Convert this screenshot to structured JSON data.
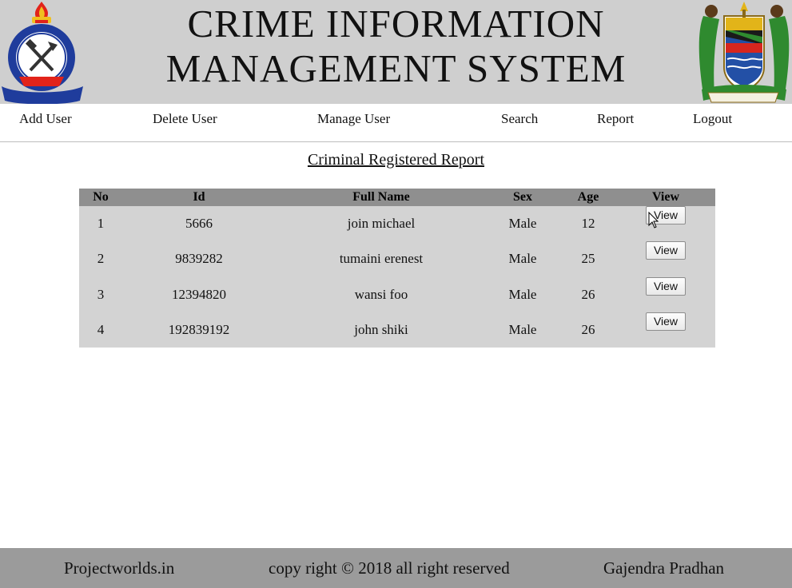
{
  "header": {
    "title_line1": "CRIME INFORMATION",
    "title_line2": "MANAGEMENT SYSTEM",
    "left_logo": {
      "icon": "police-badge-icon",
      "text_top": "TANZANIA",
      "text_center": "POLISI",
      "text_bottom": "USALAMA WA RAIA",
      "colors": {
        "blue": "#1f3c9c",
        "red": "#e2231a",
        "gold": "#f0c020"
      }
    },
    "right_logo": {
      "icon": "coat-of-arms-icon",
      "motto": "UHURU NA UMOJA",
      "colors": {
        "green": "#2f8a2f",
        "gold": "#e2b419",
        "blue": "#2350a6",
        "red": "#d7261e"
      }
    }
  },
  "nav": {
    "items": [
      {
        "label": "Add User"
      },
      {
        "label": "Delete User"
      },
      {
        "label": "Manage User"
      },
      {
        "label": "Search"
      },
      {
        "label": "Report"
      },
      {
        "label": "Logout"
      }
    ]
  },
  "report": {
    "title": "Criminal Registered Report",
    "columns": [
      "No",
      "Id",
      "Full Name",
      "Sex",
      "Age",
      "View"
    ],
    "rows": [
      {
        "no": "1",
        "id": "5666",
        "name": "join michael",
        "sex": "Male",
        "age": "12",
        "action": "View"
      },
      {
        "no": "2",
        "id": "9839282",
        "name": "tumaini erenest",
        "sex": "Male",
        "age": "25",
        "action": "View"
      },
      {
        "no": "3",
        "id": "12394820",
        "name": "wansi foo",
        "sex": "Male",
        "age": "26",
        "action": "View"
      },
      {
        "no": "4",
        "id": "192839192",
        "name": "john shiki",
        "sex": "Male",
        "age": "26",
        "action": "View"
      }
    ]
  },
  "footer": {
    "left": "Projectworlds.in",
    "center": "copy right © 2018 all right reserved",
    "right": "Gajendra Pradhan"
  },
  "colors": {
    "header_bg": "#cfcfcf",
    "table_bg": "#d3d3d3",
    "table_header_bg": "#8f8f8f",
    "footer_bg": "#9b9b9b"
  }
}
